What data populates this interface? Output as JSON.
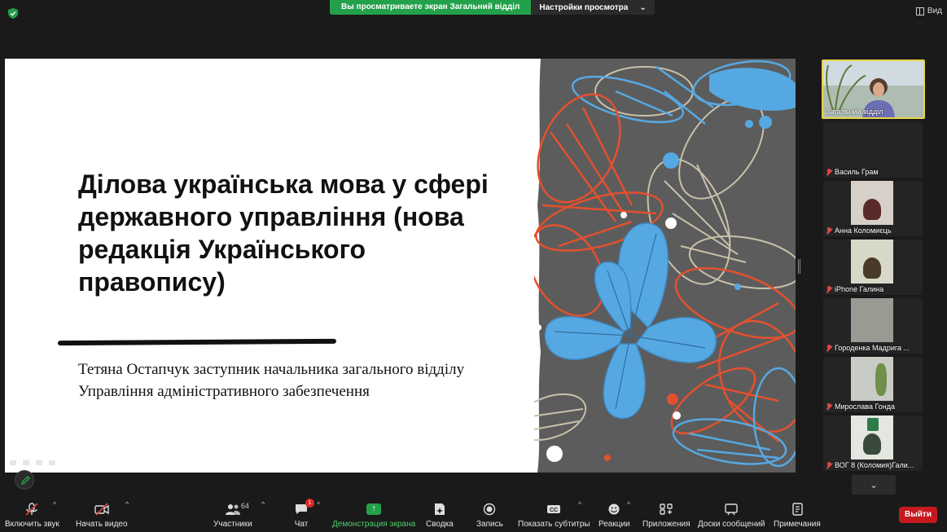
{
  "top_bar": {
    "share_banner_text": "Вы просматриваете экран Загальний відділ",
    "view_options_label": "Настройки просмотра",
    "view_button_label": "Вид"
  },
  "slide": {
    "title": "Ділова українська мова у сфері державного управління (нова редакція Українського правопису)",
    "subtitle": "Тетяна Остапчук заступник начальника загального відділу Управління адміністративного забезпечення"
  },
  "participants": [
    {
      "name": "Загальний відділ",
      "muted": false,
      "video": true
    },
    {
      "name": "Василь Грам",
      "muted": true,
      "video": false
    },
    {
      "name": "Анна Коломиєць",
      "muted": true,
      "video": true
    },
    {
      "name": "iPhone Галина",
      "muted": true,
      "video": true
    },
    {
      "name": "Городенка   Мадрига ...",
      "muted": true,
      "video": true
    },
    {
      "name": "Мирослава Гонда",
      "muted": true,
      "video": true
    },
    {
      "name": "ВОГ 8 (Коломия)Гали...",
      "muted": true,
      "video": true
    }
  ],
  "toolbar": {
    "unmute_label": "Включить звук",
    "start_video_label": "Начать видео",
    "participants_label": "Участники",
    "participants_count": "64",
    "chat_label": "Чат",
    "chat_badge": "1",
    "share_screen_label": "Демонстрация экрана",
    "summary_label": "Сводка",
    "record_label": "Запись",
    "captions_label": "Показать субтитры",
    "reactions_label": "Реакции",
    "apps_label": "Приложения",
    "whiteboard_label": "Доски сообщений",
    "notes_label": "Примечания",
    "exit_label": "Выйти"
  },
  "colors": {
    "accent_green": "#23a04a",
    "exit_red": "#c5181f",
    "active_speaker": "#e8d34a",
    "flower_orange": "#e4502e",
    "flower_blue": "#56a8e2",
    "flower_beige": "#c9c1aa"
  }
}
